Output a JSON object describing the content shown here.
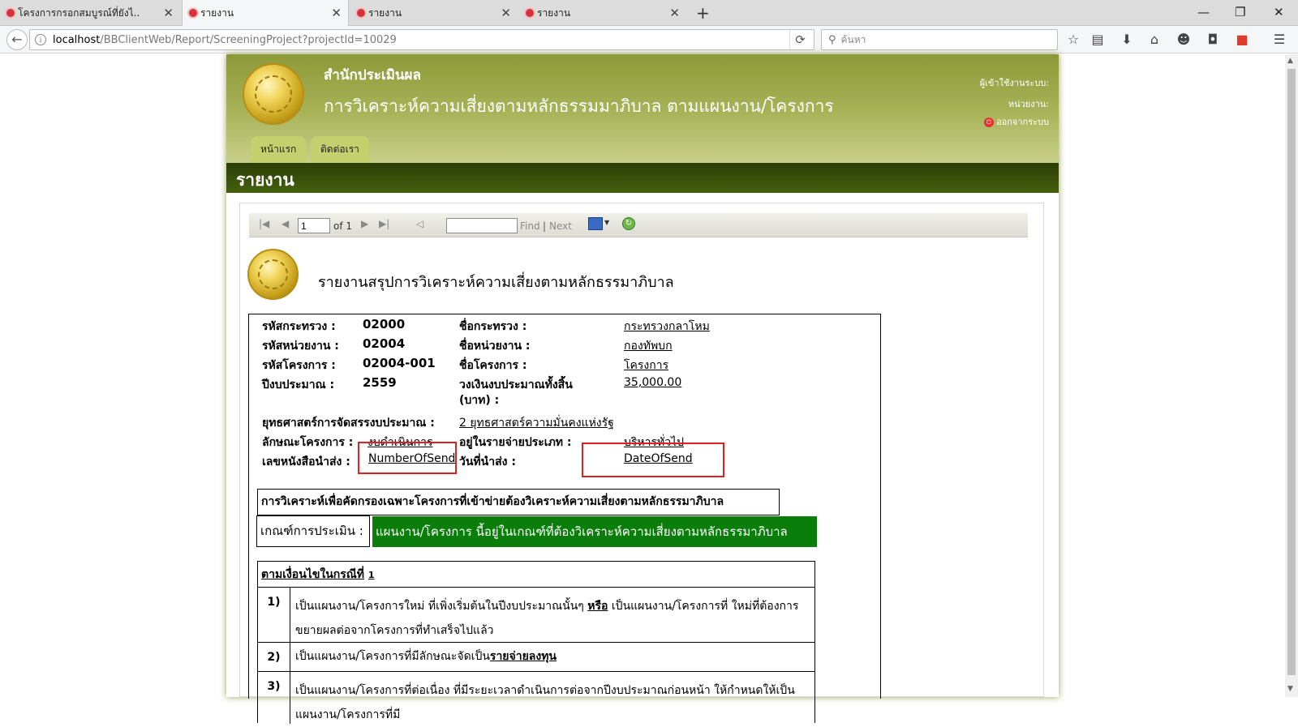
{
  "browser": {
    "tabs": [
      {
        "label": "โครงการกรอกสมบูรณ์ที่ยังไ...",
        "active": false
      },
      {
        "label": "รายงาน",
        "active": true
      },
      {
        "label": "รายงาน",
        "active": false
      },
      {
        "label": "รายงาน",
        "active": false
      }
    ],
    "url_host": "localhost",
    "url_path": "/BBClientWeb/Report/ScreeningProject?projectId=10029",
    "search_placeholder": "ค้นหา"
  },
  "header": {
    "org": "สำนักประเมินผล",
    "title": "การวิเคราะห์ความเสี่ยงตามหลักธรรมมาภิบาล ตามแผนงาน/โครงการ",
    "user_label": "ผู้เข้าใช้งานระบบ:",
    "unit_label": "หน่วยงาน:",
    "logout": "ออกจากระบบ",
    "menu": [
      "หน้าแรก",
      "ติดต่อเรา"
    ]
  },
  "page_title": "รายงาน",
  "viewer": {
    "page_value": "1",
    "of_label": "of 1",
    "find": "Find",
    "sep": "|",
    "next": "Next"
  },
  "report": {
    "title": "รายงานสรุปการวิเคราะห์ความเสี่ยงตามหลักธรรมาภิบาล",
    "ministry_code_label": "รหัสกระทรวง :",
    "ministry_code": "02000",
    "ministry_name_label": "ชื่อกระทรวง :",
    "ministry_name": "กระทรวงกลาโหม",
    "unit_code_label": "รหัสหน่วยงาน :",
    "unit_code": "02004",
    "unit_name_label": "ชื่อหน่วยงาน :",
    "unit_name": "กองทัพบก",
    "project_code_label": "รหัสโครงการ :",
    "project_code": "02004-001",
    "project_name_label": "ชื่อโครงการ :",
    "project_name": "โครงการ",
    "fiscal_year_label": "ปีงบประมาณ :",
    "fiscal_year": "2559",
    "budget_label_1": "วงเงินงบประมาณทั้งสิ้น",
    "budget_label_2": "(บาท) :",
    "budget": "35,000.00",
    "strategy_label": "ยุทธศาสตร์การจัดสรรงบประมาณ :",
    "strategy": "2 ยุทธศาสตร์ความมั่นคงแห่งรัฐ",
    "project_type_label": "ลักษณะโครงการ :",
    "project_type": "งบดำเนินการ",
    "expense_cat_label": "อยู่ในรายจ่ายประเภท :",
    "expense_cat": "บริหารทั่วไป",
    "doc_no_label": "เลขหนังสือนำส่ง :",
    "doc_no": "NumberOfSend",
    "send_date_label": "วันที่นำส่ง :",
    "send_date": "DateOfSend",
    "section_title": "การวิเคราะห์เพื่อคัดกรองเฉพาะโครงการที่เข้าข่ายต้องวิเคราะห์ความเสี่ยงตามหลักธรรมาภิบาล",
    "criteria_label": "เกณฑ์การประเมิน :",
    "criteria_value": "แผนงาน/โครงการ นี้อยู่ในเกณฑ์ที่ต้องวิเคราะห์ความเสี่ยงตามหลักธรรมาภิบาล",
    "condition_prefix": "ตามเงื่อนไขในกรณีที่",
    "condition_no": "1",
    "conditions": [
      {
        "num": "1)",
        "text_a": "เป็นแผนงาน/โครงการใหม่ ที่เพิ่งเริ่มต้นในปีงบประมาณนั้นๆ",
        "bold": "หรือ",
        "text_b": "เป็นแผนงาน/โครงการที่ ใหม่ที่ต้องการขยายผลต่อจากโครงการที่ทำเสร็จไปแล้ว"
      },
      {
        "num": "2)",
        "text_a": "เป็นแผนงาน/โครงการที่มีลักษณะจัดเป็น",
        "bold": "รายจ่ายลงทุน",
        "text_b": ""
      },
      {
        "num": "3)",
        "text_a": "เป็นแผนงาน/โครงการที่ต่อเนื่อง ที่มีระยะเวลาดำเนินการต่อจากปีงบประมาณก่อนหน้า ให้กำหนดให้เป็นแผนงาน/โครงการที่มี",
        "bold": "",
        "text_b": ""
      }
    ]
  }
}
